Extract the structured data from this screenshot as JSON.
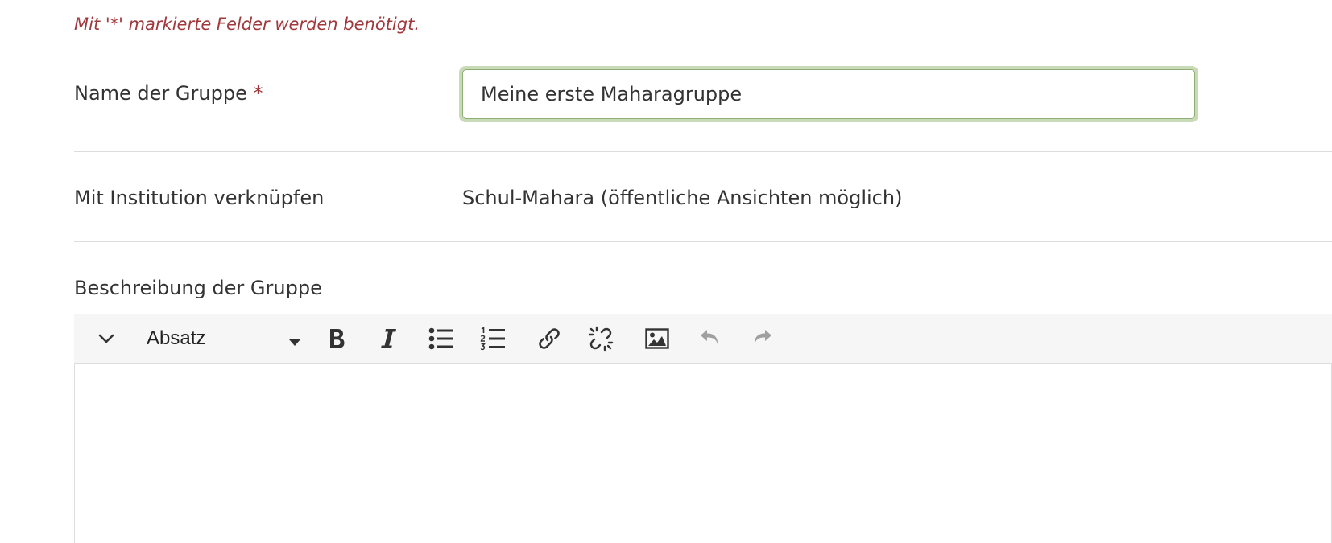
{
  "form": {
    "required_note": "Mit '*' markierte Felder werden benötigt.",
    "name": {
      "label": "Name der Gruppe",
      "required_marker": "*",
      "value": "Meine erste Maharagruppe"
    },
    "institution": {
      "label": "Mit Institution verknüpfen",
      "value": "Schul-Mahara (öffentliche Ansichten möglich)"
    },
    "description": {
      "label": "Beschreibung der Gruppe",
      "toolbar": {
        "format_value": "Absatz",
        "icons": [
          "chevron-down-icon",
          "bold-icon",
          "italic-icon",
          "bullet-list-icon",
          "numbered-list-icon",
          "link-icon",
          "unlink-icon",
          "image-icon",
          "undo-icon",
          "redo-icon"
        ]
      },
      "content": ""
    }
  },
  "colors": {
    "required": "#a0393c",
    "text": "#333333",
    "input_focus_border": "#8fae73",
    "input_focus_glow": "#c9dab8",
    "toolbar_bg": "#f6f6f6",
    "divider": "#dddddd",
    "icon_disabled": "#a0a0a0"
  }
}
